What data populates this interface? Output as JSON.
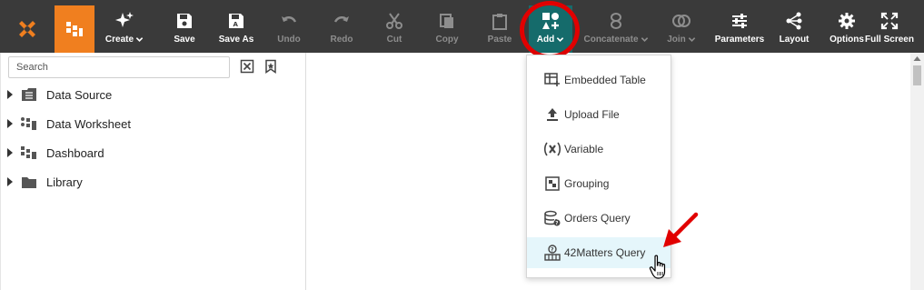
{
  "toolbar": {
    "create_label": "Create",
    "save_label": "Save",
    "save_as_label": "Save As",
    "undo_label": "Undo",
    "redo_label": "Redo",
    "cut_label": "Cut",
    "copy_label": "Copy",
    "paste_label": "Paste",
    "add_label": "Add",
    "concatenate_label": "Concatenate",
    "join_label": "Join",
    "parameters_label": "Parameters",
    "layout_label": "Layout",
    "options_label": "Options",
    "full_screen_label": "Full Screen"
  },
  "sidebar": {
    "search_placeholder": "Search",
    "items": [
      {
        "label": "Data Source",
        "icon": "data-source-icon"
      },
      {
        "label": "Data Worksheet",
        "icon": "data-worksheet-icon"
      },
      {
        "label": "Dashboard",
        "icon": "dashboard-icon"
      },
      {
        "label": "Library",
        "icon": "folder-icon"
      }
    ]
  },
  "add_menu": {
    "items": [
      {
        "label": "Embedded Table",
        "icon": "embedded-table-icon"
      },
      {
        "label": "Upload File",
        "icon": "upload-icon"
      },
      {
        "label": "Variable",
        "icon": "variable-icon"
      },
      {
        "label": "Grouping",
        "icon": "grouping-icon"
      },
      {
        "label": "Orders Query",
        "icon": "database-query-icon"
      },
      {
        "label": "42Matters Query",
        "icon": "rest-query-icon"
      }
    ]
  },
  "colors": {
    "toolbar_bg": "#3a3a3a",
    "accent_orange": "#f07f1f",
    "active_teal": "#156b6b",
    "highlight_red": "#e10000",
    "menu_hover": "#e5f6fb"
  }
}
